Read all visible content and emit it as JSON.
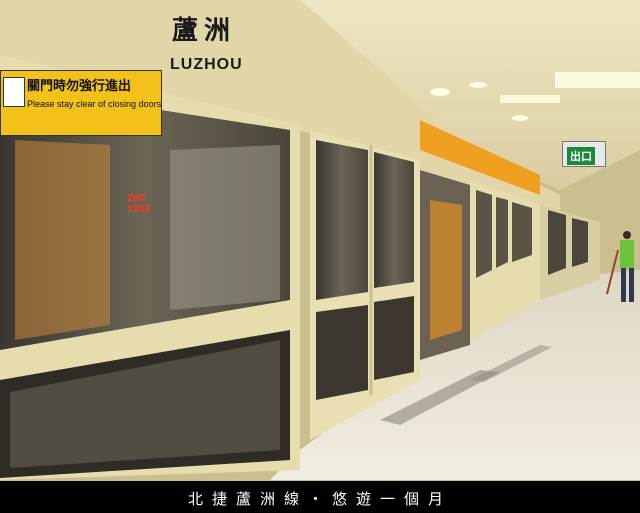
{
  "station": {
    "name_zh": "蘆洲",
    "name_en": "LUZHOU"
  },
  "door_warning": {
    "text_zh": "關門時勿強行進出",
    "text_en": "Please stay clear of closing doors"
  },
  "train_display": {
    "line1": "ZHO",
    "line2": "XINS"
  },
  "exit_sign": {
    "text": "出口"
  },
  "caption": {
    "text": "北捷蘆洲線・悠遊一個月"
  },
  "colors": {
    "wall": "#cbbf8f",
    "door_frame": "#e6dcae",
    "floor": "#e9e3d3",
    "warning_yellow": "#f2c21b",
    "accent_orange": "#f0a020",
    "caption_bg": "#000000"
  }
}
